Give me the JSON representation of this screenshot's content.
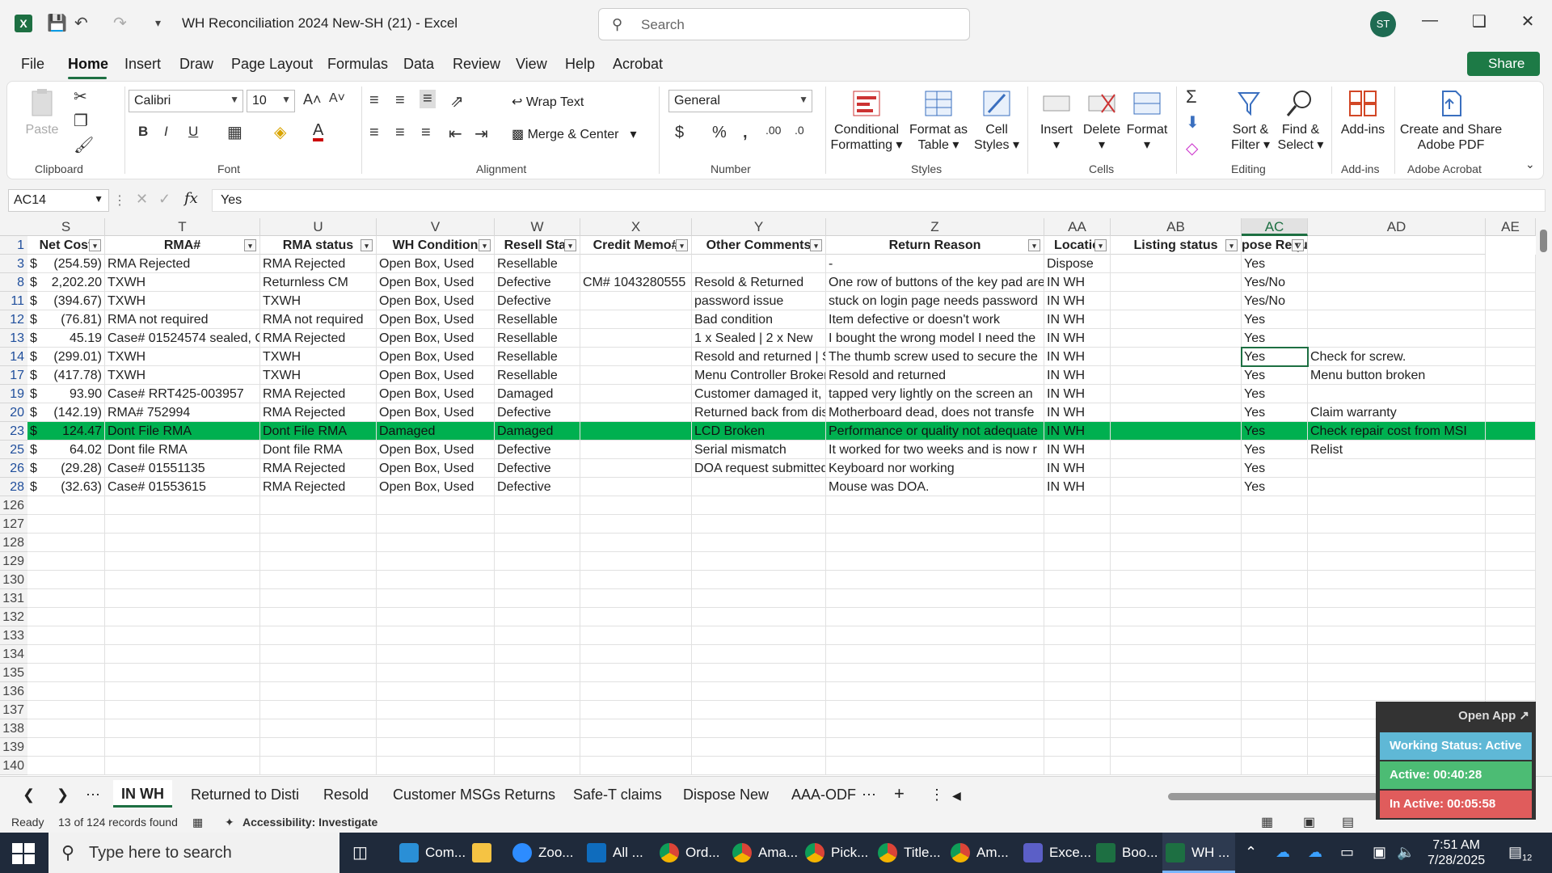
{
  "titlebar": {
    "title": "WH Reconciliation 2024 New-SH (21)  -  Excel",
    "search_placeholder": "Search",
    "avatar": "ST"
  },
  "menu": {
    "tabs": [
      "File",
      "Home",
      "Insert",
      "Draw",
      "Page Layout",
      "Formulas",
      "Data",
      "Review",
      "View",
      "Help",
      "Acrobat"
    ],
    "share": "Share"
  },
  "ribbon": {
    "clipboard": "Clipboard",
    "paste": "Paste",
    "font_label": "Font",
    "font_name": "Calibri",
    "font_size": "10",
    "alignment": "Alignment",
    "wrap": "Wrap Text",
    "merge": "Merge & Center",
    "number": "Number",
    "number_format": "General",
    "styles": "Styles",
    "cond": "Conditional",
    "cond2": "Formatting",
    "fmt_table": "Format as",
    "fmt_table2": "Table",
    "cell_styles": "Cell",
    "cell_styles2": "Styles",
    "cells": "Cells",
    "insert": "Insert",
    "delete": "Delete",
    "format": "Format",
    "editing": "Editing",
    "sort": "Sort &",
    "sort2": "Filter",
    "find": "Find &",
    "find2": "Select",
    "addins_label": "Add-ins",
    "addins": "Add-ins",
    "acrobat_label": "Adobe Acrobat",
    "acrobat": "Create and Share",
    "acrobat2": "Adobe PDF"
  },
  "formula": {
    "namebox": "AC14",
    "fx": "fx",
    "value": "Yes"
  },
  "columns": [
    "S",
    "T",
    "U",
    "V",
    "W",
    "X",
    "Y",
    "Z",
    "AA",
    "AB",
    "AC",
    "AD",
    "AE"
  ],
  "headers": [
    "Net Cost",
    "RMA#",
    "RMA status",
    "WH Condition",
    "Resell Stat",
    "Credit Memo#",
    "Other Comments",
    "Return Reason",
    "Locatio",
    "Listing status",
    "pose Required",
    ""
  ],
  "rows": [
    {
      "n": "3",
      "cells": [
        "$",
        "(254.59)",
        "RMA Rejected",
        "RMA Rejected",
        "Open Box, Used",
        "Resellable",
        "",
        "",
        "-",
        "Dispose",
        "",
        "Yes",
        ""
      ]
    },
    {
      "n": "8",
      "cells": [
        "$",
        "2,202.20",
        "TXWH",
        "Returnless CM",
        "Open Box, Used",
        "Defective",
        "CM# 1043280555",
        "Resold & Returned",
        "One row of buttons of the key pad are",
        "IN WH",
        "",
        "Yes/No",
        ""
      ]
    },
    {
      "n": "11",
      "cells": [
        "$",
        "(394.67)",
        "TXWH",
        "TXWH",
        "Open Box, Used",
        "Defective",
        "",
        "password issue",
        "stuck on login page needs password",
        "IN WH",
        "",
        "Yes/No",
        ""
      ]
    },
    {
      "n": "12",
      "cells": [
        "$",
        "(76.81)",
        "RMA not required",
        "RMA not required",
        "Open Box, Used",
        "Resellable",
        "",
        "Bad condition",
        "Item defective or doesn't work",
        "IN WH",
        "",
        "Yes",
        ""
      ]
    },
    {
      "n": "13",
      "cells": [
        "$",
        "45.19",
        "Case# 01524574 sealed, Case",
        "RMA Rejected",
        "Open Box, Used",
        "Resellable",
        "",
        "1 x Sealed | 2 x New",
        "I bought the wrong model I need the",
        "IN WH",
        "",
        "Yes",
        ""
      ]
    },
    {
      "n": "14",
      "cells": [
        "$",
        "(299.01)",
        "TXWH",
        "TXWH",
        "Open Box, Used",
        "Resellable",
        "",
        "Resold and returned | S",
        "The thumb screw used to secure the",
        "IN WH",
        "",
        "Yes",
        "Check for screw."
      ]
    },
    {
      "n": "17",
      "cells": [
        "$",
        "(417.78)",
        "TXWH",
        "TXWH",
        "Open Box, Used",
        "Resellable",
        "",
        "Menu Controller Broken",
        "Resold and returned",
        "IN WH",
        "",
        "Yes",
        "Menu button broken"
      ]
    },
    {
      "n": "19",
      "cells": [
        "$",
        "93.90",
        "Case# RRT425-003957",
        "RMA Rejected",
        "Open Box, Used",
        "Damaged",
        "",
        "Customer damaged it, r",
        "tapped very lightly on the screen an",
        "IN WH",
        "",
        "Yes",
        ""
      ]
    },
    {
      "n": "20",
      "cells": [
        "$",
        "(142.19)",
        "RMA# 752994",
        "RMA Rejected",
        "Open Box, Used",
        "Defective",
        "",
        "Returned back from dis",
        "Motherboard dead, does not transfe",
        "IN WH",
        "",
        "Yes",
        "Claim warranty"
      ]
    },
    {
      "n": "23",
      "cells": [
        "$",
        "124.47",
        "Dont File RMA",
        "Dont File RMA",
        "Damaged",
        "Damaged",
        "",
        "LCD Broken",
        "Performance or quality not adequate",
        "IN WH",
        "",
        "Yes",
        "Check repair cost from MSI"
      ]
    },
    {
      "n": "25",
      "cells": [
        "$",
        "64.02",
        "Dont file RMA",
        "Dont file RMA",
        "Open Box, Used",
        "Defective",
        "",
        "Serial mismatch",
        "It worked for two weeks and is now r",
        "IN WH",
        "",
        "Yes",
        "Relist"
      ]
    },
    {
      "n": "26",
      "cells": [
        "$",
        "(29.28)",
        "Case# 01551135",
        "RMA Rejected",
        "Open Box, Used",
        "Defective",
        "",
        "DOA request submitted",
        "Keyboard nor working",
        "IN WH",
        "",
        "Yes",
        ""
      ]
    },
    {
      "n": "28",
      "cells": [
        "$",
        "(32.63)",
        "Case# 01553615",
        "RMA Rejected",
        "Open Box, Used",
        "Defective",
        "",
        "",
        "Mouse was DOA.",
        "IN WH",
        "",
        "Yes",
        ""
      ]
    }
  ],
  "empty_rows": [
    "126",
    "127",
    "128",
    "129",
    "130",
    "131",
    "132",
    "133",
    "134",
    "135",
    "136",
    "137",
    "138",
    "139",
    "140"
  ],
  "header_row": "1",
  "sheets": [
    "IN WH",
    "Returned to Disti",
    "Resold",
    "Customer MSGs Returns",
    "Safe-T claims",
    "Dispose New",
    "AAA-ODF"
  ],
  "status": {
    "ready": "Ready",
    "records": "13 of 124 records found",
    "accessibility": "Accessibility: Investigate"
  },
  "widget": {
    "open": "Open App ↗",
    "working": "Working Status: Active",
    "active": "Active: 00:40:28",
    "inactive": "In Active: 00:05:58"
  },
  "taskbar": {
    "search": "Type here to search",
    "apps": [
      "Com...",
      "",
      "Zoo...",
      "All ...",
      "Ord...",
      "Ama...",
      "Pick...",
      "Title...",
      "Am...",
      "Exce...",
      "Boo...",
      "WH ..."
    ],
    "time": "7:51 AM",
    "date": "7/28/2025",
    "notif": "12"
  },
  "colors": {
    "excel_green": "#1d6f42",
    "highlight_row": "#00b050",
    "taskbar": "#1f2a3b"
  }
}
